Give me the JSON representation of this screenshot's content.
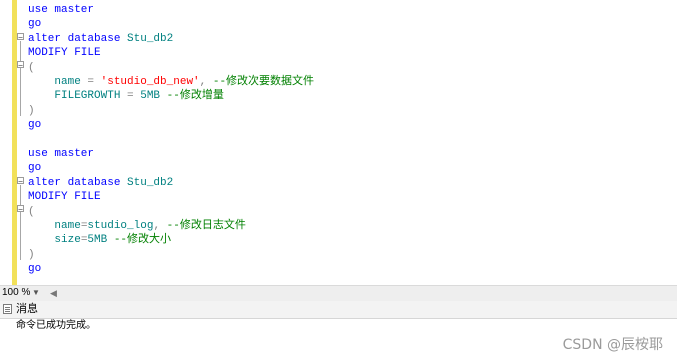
{
  "editor": {
    "lines": [
      {
        "segments": [
          {
            "t": "use master",
            "c": "kw"
          }
        ]
      },
      {
        "segments": [
          {
            "t": "go",
            "c": "kw"
          }
        ]
      },
      {
        "segments": [
          {
            "t": "alter database ",
            "c": "kw"
          },
          {
            "t": "Stu_db2",
            "c": "id"
          }
        ]
      },
      {
        "segments": [
          {
            "t": "MODIFY FILE",
            "c": "kw"
          }
        ]
      },
      {
        "segments": [
          {
            "t": "(",
            "c": "gray"
          }
        ]
      },
      {
        "segments": [
          {
            "t": "    name ",
            "c": "id"
          },
          {
            "t": "= ",
            "c": "gray"
          },
          {
            "t": "'studio_db_new'",
            "c": "str"
          },
          {
            "t": ", ",
            "c": "gray"
          },
          {
            "t": "--修改次要数据文件",
            "c": "cm"
          }
        ]
      },
      {
        "segments": [
          {
            "t": "    FILEGROWTH ",
            "c": "id"
          },
          {
            "t": "= ",
            "c": "gray"
          },
          {
            "t": "5MB ",
            "c": "id"
          },
          {
            "t": "--修改增量",
            "c": "cm"
          }
        ]
      },
      {
        "segments": [
          {
            "t": ")",
            "c": "gray"
          }
        ]
      },
      {
        "segments": [
          {
            "t": "go",
            "c": "kw"
          }
        ]
      },
      {
        "segments": [
          {
            "t": "",
            "c": "kw"
          }
        ]
      },
      {
        "segments": [
          {
            "t": "use master",
            "c": "kw"
          }
        ]
      },
      {
        "segments": [
          {
            "t": "go",
            "c": "kw"
          }
        ]
      },
      {
        "segments": [
          {
            "t": "alter database ",
            "c": "kw"
          },
          {
            "t": "Stu_db2",
            "c": "id"
          }
        ]
      },
      {
        "segments": [
          {
            "t": "MODIFY FILE",
            "c": "kw"
          }
        ]
      },
      {
        "segments": [
          {
            "t": "(",
            "c": "gray"
          }
        ]
      },
      {
        "segments": [
          {
            "t": "    name",
            "c": "id"
          },
          {
            "t": "=",
            "c": "gray"
          },
          {
            "t": "studio_log",
            "c": "id"
          },
          {
            "t": ", ",
            "c": "gray"
          },
          {
            "t": "--修改日志文件",
            "c": "cm"
          }
        ]
      },
      {
        "segments": [
          {
            "t": "    size",
            "c": "id"
          },
          {
            "t": "=",
            "c": "gray"
          },
          {
            "t": "5MB ",
            "c": "id"
          },
          {
            "t": "--修改大小",
            "c": "cm"
          }
        ]
      },
      {
        "segments": [
          {
            "t": ")",
            "c": "gray"
          }
        ]
      },
      {
        "segments": [
          {
            "t": "go",
            "c": "kw"
          }
        ]
      }
    ]
  },
  "status": {
    "zoom": "100 %",
    "zoom_arrow": "▼",
    "scroll_left": "◀"
  },
  "messages": {
    "tab_label": "消息",
    "text": "命令已成功完成。"
  },
  "watermark": "CSDN @辰桉耶"
}
